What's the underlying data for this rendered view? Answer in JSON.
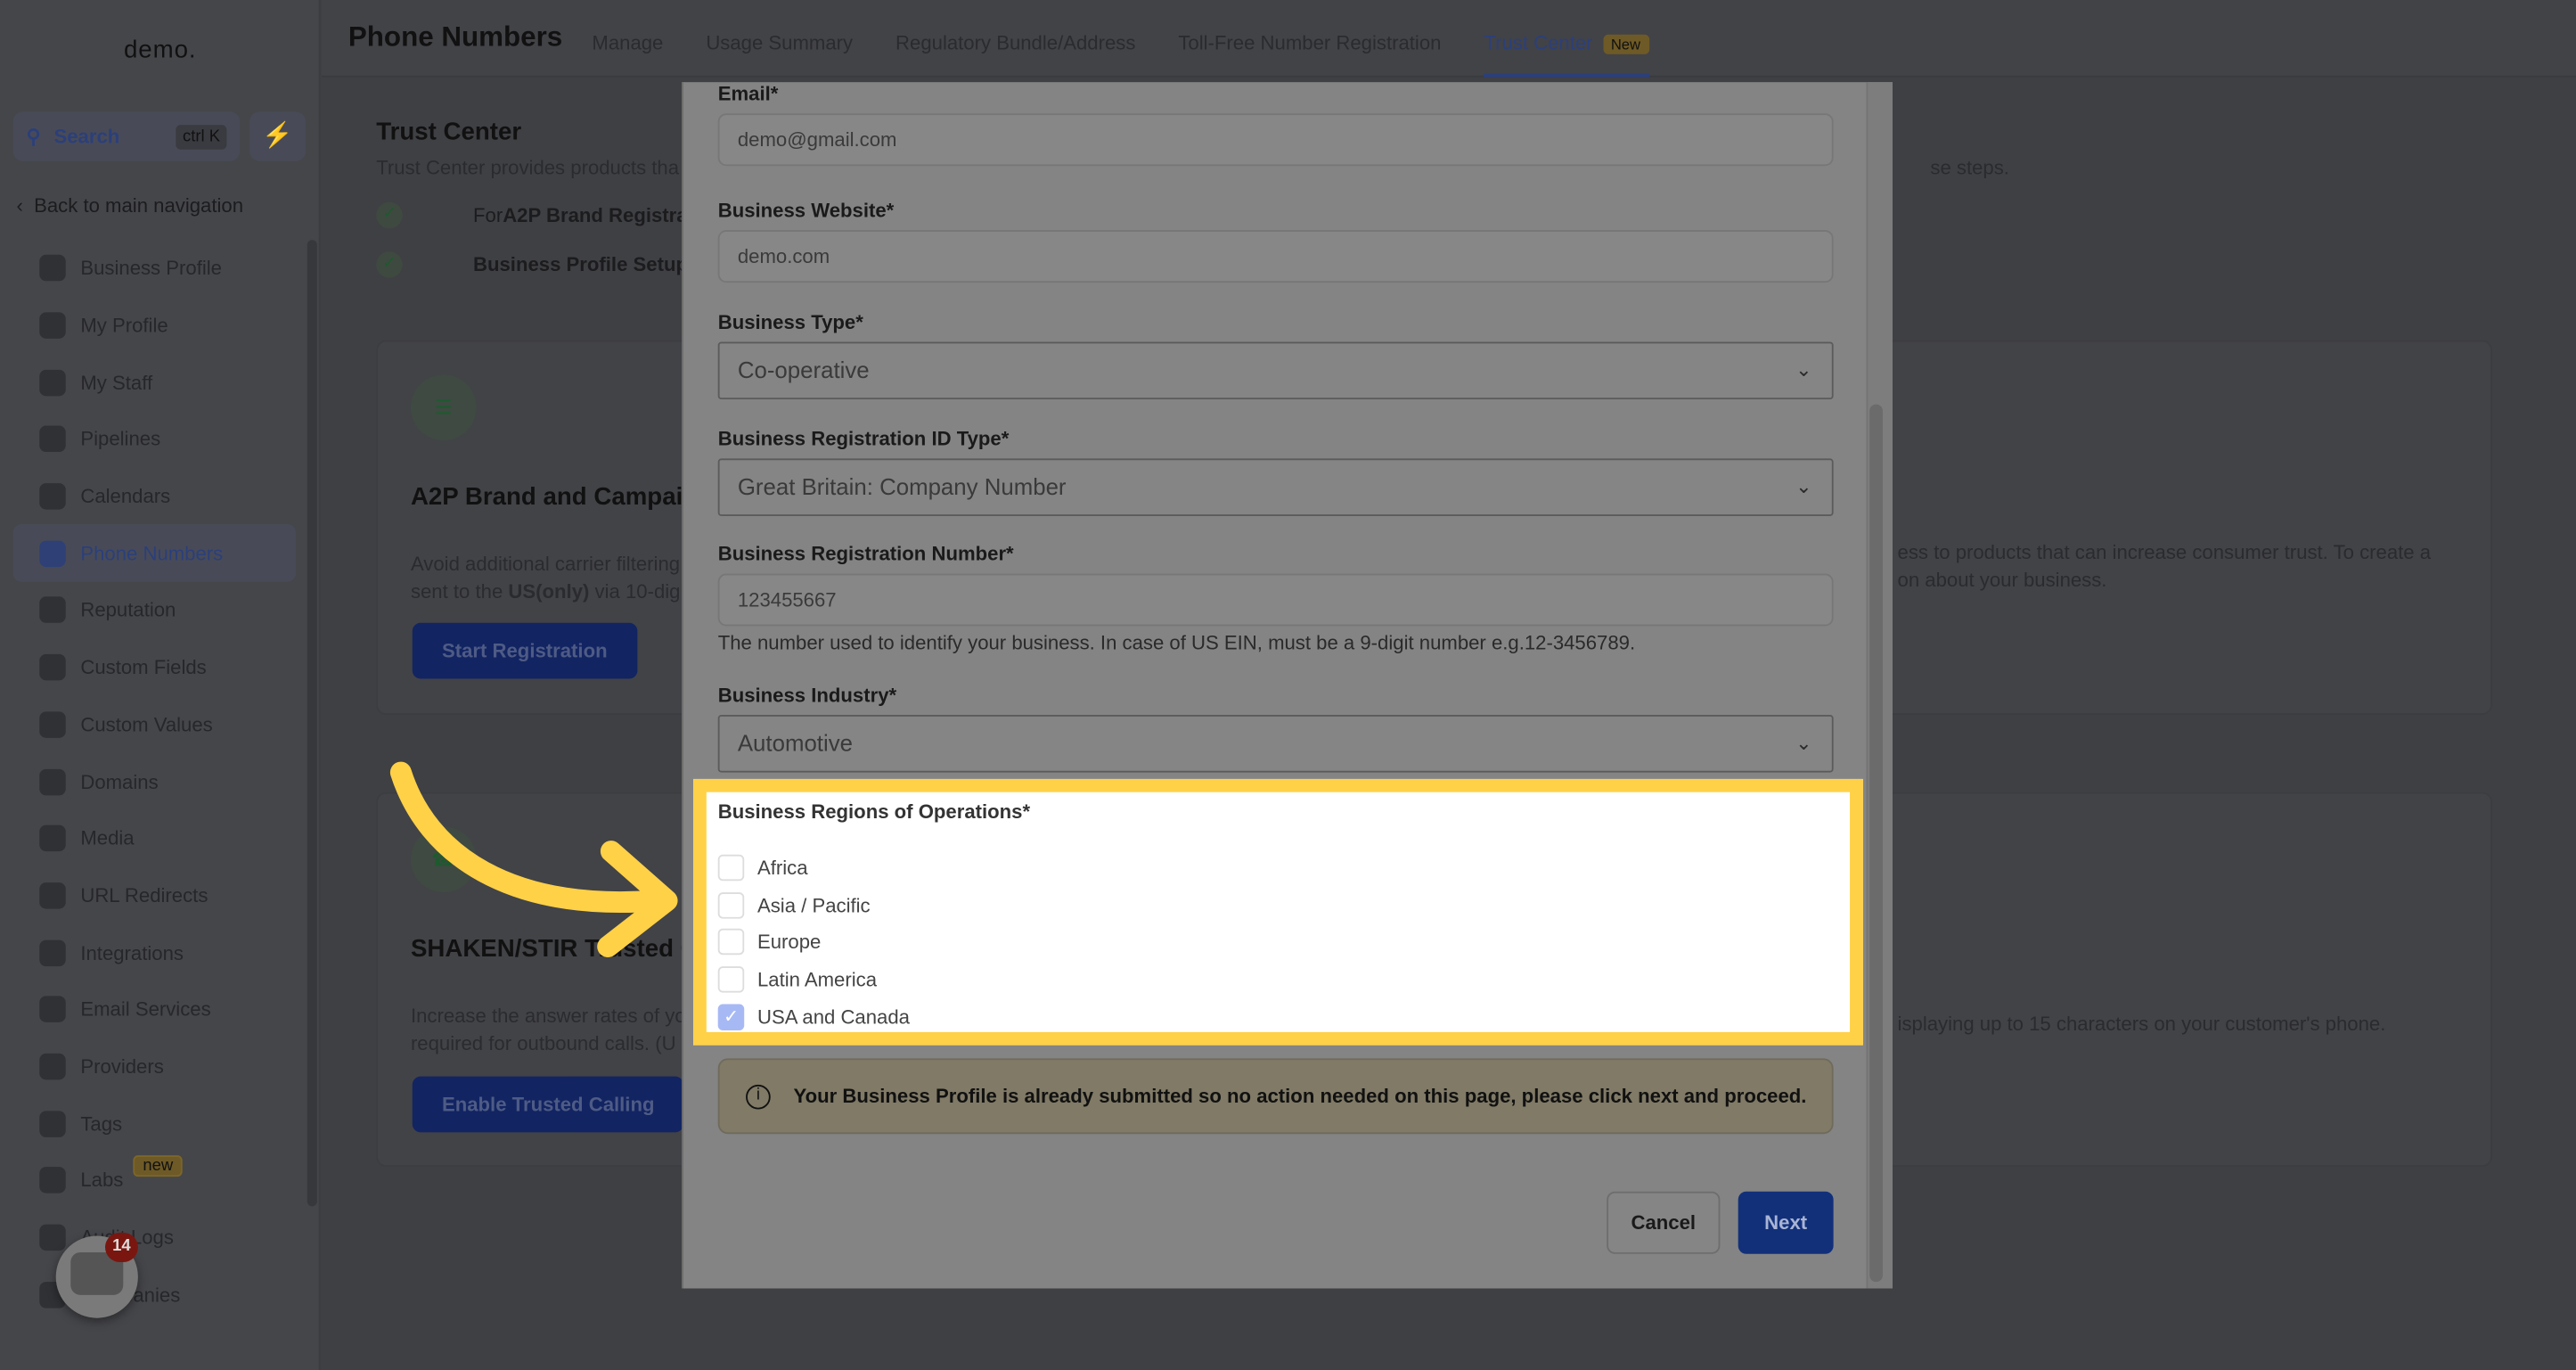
{
  "sidebar": {
    "logo": "demo.",
    "search_label": "Search",
    "search_shortcut": "ctrl K",
    "back_label": "Back to main navigation",
    "items": [
      {
        "label": "Business Profile",
        "icon": "briefcase-icon"
      },
      {
        "label": "My Profile",
        "icon": "user-circle-icon"
      },
      {
        "label": "My Staff",
        "icon": "user-icon"
      },
      {
        "label": "Pipelines",
        "icon": "funnel-icon"
      },
      {
        "label": "Calendars",
        "icon": "calendar-icon"
      },
      {
        "label": "Phone Numbers",
        "icon": "phone-icon",
        "active": true
      },
      {
        "label": "Reputation",
        "icon": "star-icon"
      },
      {
        "label": "Custom Fields",
        "icon": "fields-icon"
      },
      {
        "label": "Custom Values",
        "icon": "values-icon"
      },
      {
        "label": "Domains",
        "icon": "globe-icon"
      },
      {
        "label": "Media",
        "icon": "media-icon"
      },
      {
        "label": "URL Redirects",
        "icon": "redirect-icon"
      },
      {
        "label": "Integrations",
        "icon": "integrations-icon"
      },
      {
        "label": "Email Services",
        "icon": "email-icon"
      },
      {
        "label": "Providers",
        "icon": "check-box-icon"
      },
      {
        "label": "Tags",
        "icon": "tag-icon"
      },
      {
        "label": "Labs",
        "icon": "flask-icon",
        "badge": "new"
      },
      {
        "label": "Audit Logs",
        "icon": "bar-chart-icon"
      },
      {
        "label": "Companies",
        "icon": "building-icon"
      }
    ],
    "chat_count": "14"
  },
  "header": {
    "title": "Phone Numbers",
    "tabs": [
      {
        "label": "Manage"
      },
      {
        "label": "Usage Summary"
      },
      {
        "label": "Regulatory Bundle/Address"
      },
      {
        "label": "Toll-Free Number Registration"
      },
      {
        "label": "Trust Center",
        "active": true,
        "badge": "New"
      }
    ]
  },
  "main": {
    "title": "Trust Center",
    "subtitle": "Trust Center provides products tha",
    "subtitle_end": "se steps.",
    "steps": [
      {
        "prefix": "For ",
        "bold": "A2P Brand Registra"
      },
      {
        "prefix": "",
        "bold": "Business Profile Setup"
      }
    ],
    "card1": {
      "title": "A2P Brand and Campaig",
      "desc_1": "Avoid additional carrier filtering",
      "desc_2a": "sent to the ",
      "desc_2b": "US(only)",
      "desc_2c": " via 10-digi",
      "desc_right_1": "ess to products that can increase consumer trust. To create a",
      "desc_right_2": "on about your business.",
      "button": "Start Registration"
    },
    "card2": {
      "title": "SHAKEN/STIR Trusted C",
      "desc_1": "Increase the answer rates of yo",
      "desc_2": "required for outbound calls. (U",
      "desc_right": "isplaying up to 15 characters on your customer's phone.",
      "button": "Enable Trusted Calling"
    }
  },
  "modal": {
    "email": {
      "label": "Email*",
      "value": "demo@gmail.com"
    },
    "website": {
      "label": "Business Website*",
      "value": "demo.com"
    },
    "type": {
      "label": "Business Type*",
      "value": "Co-operative"
    },
    "reg_id_type": {
      "label": "Business Registration ID Type*",
      "value": "Great Britain: Company Number"
    },
    "reg_number": {
      "label": "Business Registration Number*",
      "value": "123455667",
      "help": "The number used to identify your business. In case of US EIN, must be a 9-digit number e.g.12-3456789."
    },
    "industry": {
      "label": "Business Industry*",
      "value": "Automotive"
    },
    "regions": {
      "label": "Business Regions of Operations*",
      "options": [
        {
          "label": "Africa",
          "checked": false
        },
        {
          "label": "Asia / Pacific",
          "checked": false
        },
        {
          "label": "Europe",
          "checked": false
        },
        {
          "label": "Latin America",
          "checked": false
        },
        {
          "label": "USA and Canada",
          "checked": true
        }
      ]
    },
    "info": "Your Business Profile is already submitted so no action needed on this page, please click next and proceed.",
    "cancel": "Cancel",
    "next": "Next"
  },
  "colors": {
    "highlight": "#ffd147",
    "primary": "#12307a",
    "checkbox_checked": "#a7b9f5"
  }
}
